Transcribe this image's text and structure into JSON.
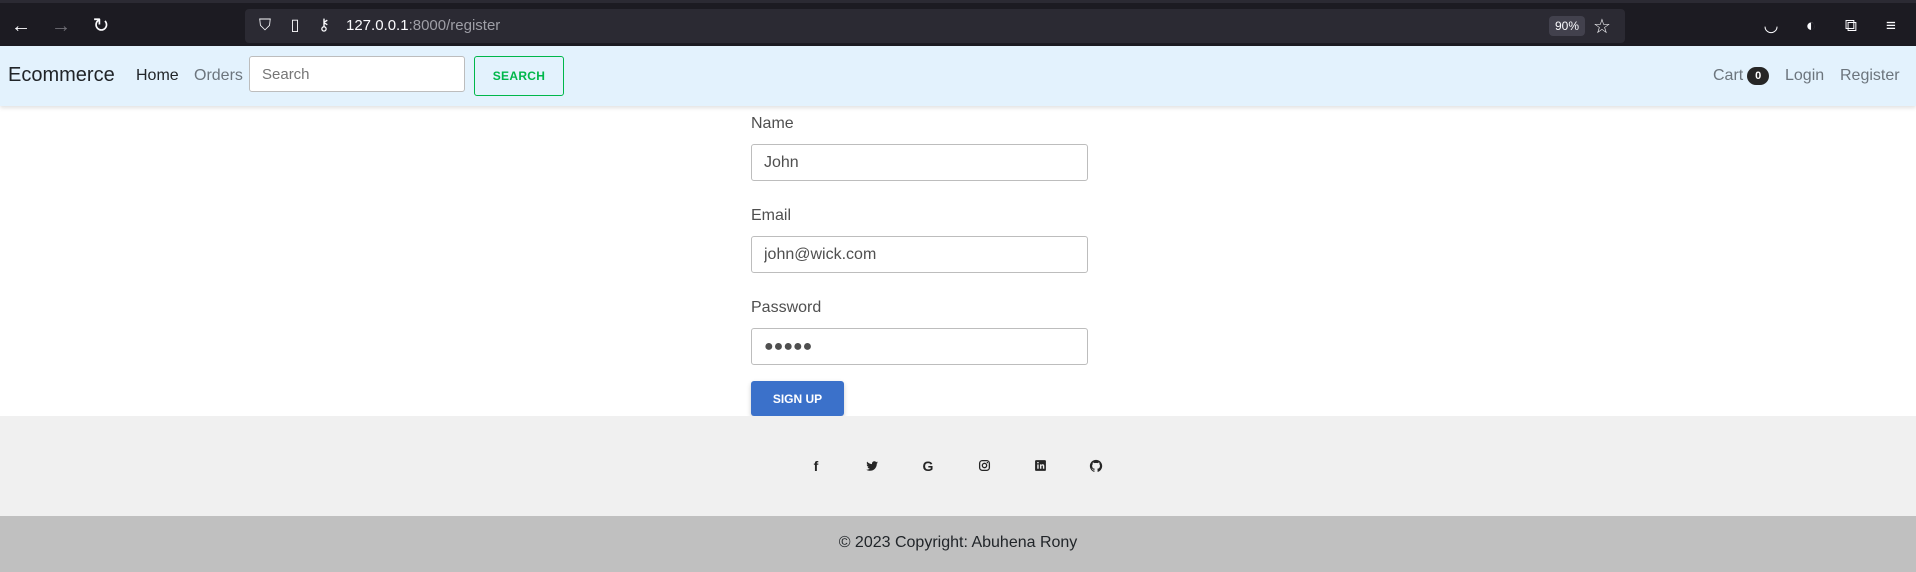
{
  "browser": {
    "url_host": "127.0.0.1",
    "url_path": ":8000/register",
    "zoom": "90%"
  },
  "navbar": {
    "brand": "Ecommerce",
    "home": "Home",
    "orders": "Orders",
    "search_placeholder": "Search",
    "search_button": "SEARCH",
    "cart": "Cart",
    "cart_count": "0",
    "login": "Login",
    "register": "Register"
  },
  "form": {
    "name_label": "Name",
    "name_value": "John",
    "email_label": "Email",
    "email_value": "john@wick.com",
    "password_label": "Password",
    "password_value": "●●●●●",
    "signup_button": "SIGN UP"
  },
  "footer": {
    "social_icons": [
      "facebook-icon",
      "twitter-icon",
      "google-icon",
      "instagram-icon",
      "linkedin-icon",
      "github-icon"
    ],
    "copyright": "© 2023 Copyright: Abuhena Rony"
  },
  "colors": {
    "navbar_bg": "#e3f2fd",
    "search_button": "#00b74a",
    "signup_button": "#3b71ca",
    "footer_social_bg": "#f0f0f0",
    "footer_copy_bg": "#c0c0c0"
  }
}
